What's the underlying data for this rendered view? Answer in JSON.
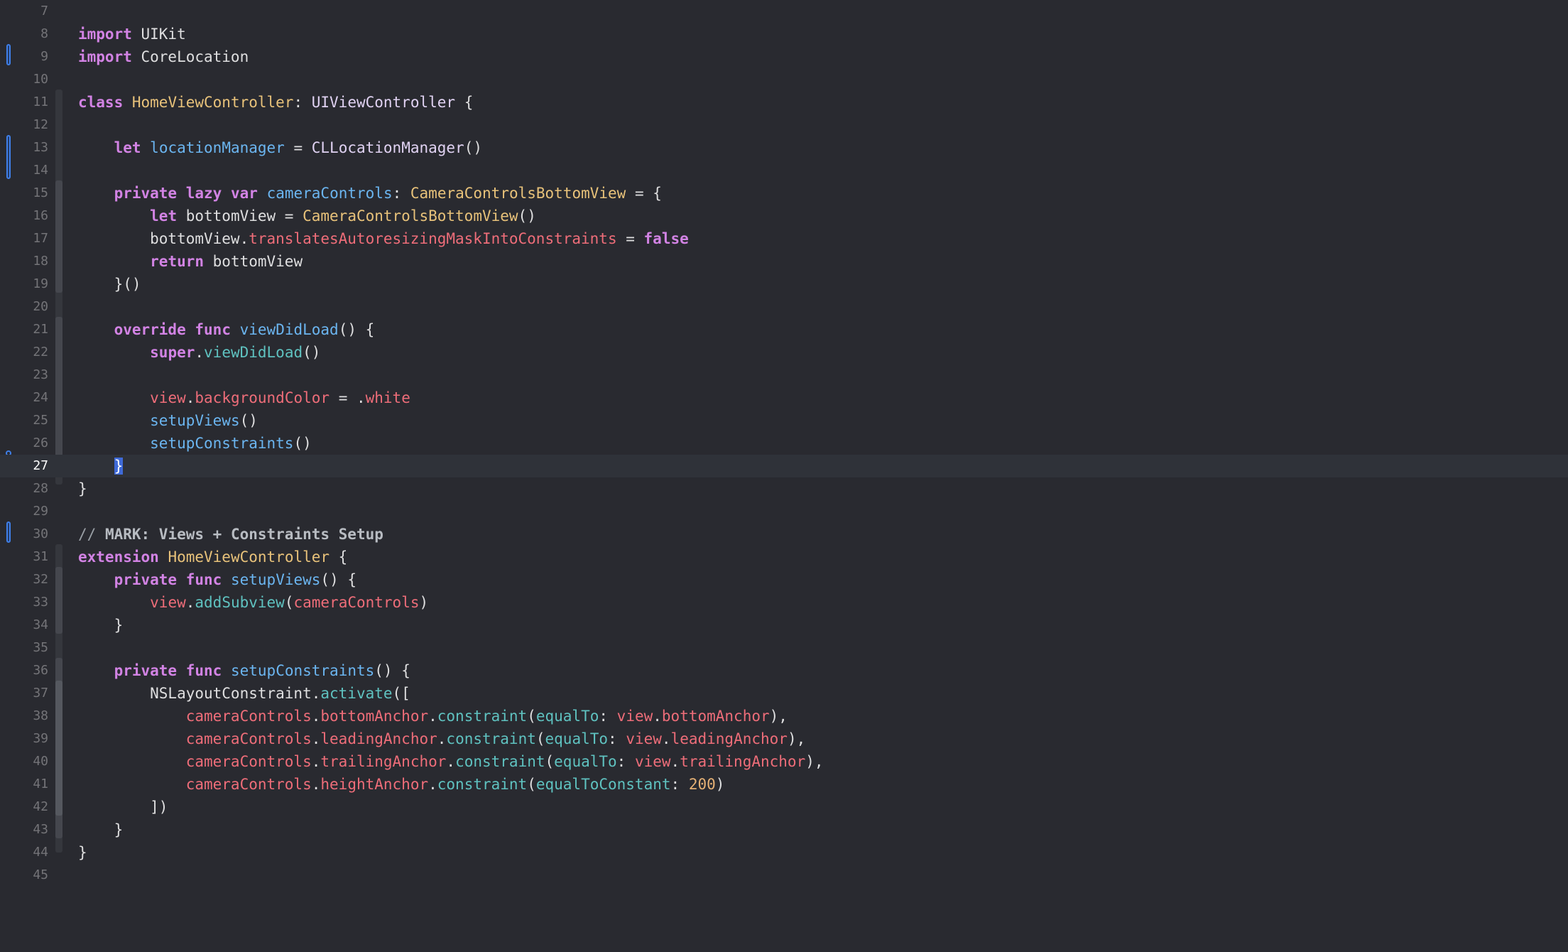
{
  "editor": {
    "language": "swift",
    "current_line": 27,
    "lines": [
      {
        "n": "7",
        "tokens": []
      },
      {
        "n": "8",
        "tokens": [
          {
            "t": "import",
            "c": "kw"
          },
          {
            "t": " UIKit",
            "c": ""
          }
        ]
      },
      {
        "n": "9",
        "tokens": [
          {
            "t": "import",
            "c": "kw"
          },
          {
            "t": " CoreLocation",
            "c": ""
          }
        ]
      },
      {
        "n": "10",
        "tokens": []
      },
      {
        "n": "11",
        "tokens": [
          {
            "t": "class",
            "c": "kw"
          },
          {
            "t": " ",
            "c": ""
          },
          {
            "t": "HomeViewController",
            "c": "typ"
          },
          {
            "t": ": ",
            "c": ""
          },
          {
            "t": "UIViewController",
            "c": "sys"
          },
          {
            "t": " {",
            "c": ""
          }
        ]
      },
      {
        "n": "12",
        "tokens": []
      },
      {
        "n": "13",
        "tokens": [
          {
            "t": "    ",
            "c": ""
          },
          {
            "t": "let",
            "c": "kw"
          },
          {
            "t": " ",
            "c": ""
          },
          {
            "t": "locationManager",
            "c": "decl"
          },
          {
            "t": " = ",
            "c": ""
          },
          {
            "t": "CLLocationManager",
            "c": "sys"
          },
          {
            "t": "()",
            "c": ""
          }
        ]
      },
      {
        "n": "14",
        "tokens": []
      },
      {
        "n": "15",
        "tokens": [
          {
            "t": "    ",
            "c": ""
          },
          {
            "t": "private",
            "c": "kw"
          },
          {
            "t": " ",
            "c": ""
          },
          {
            "t": "lazy",
            "c": "kw"
          },
          {
            "t": " ",
            "c": ""
          },
          {
            "t": "var",
            "c": "kw"
          },
          {
            "t": " ",
            "c": ""
          },
          {
            "t": "cameraControls",
            "c": "decl"
          },
          {
            "t": ": ",
            "c": ""
          },
          {
            "t": "CameraControlsBottomView",
            "c": "typ"
          },
          {
            "t": " = {",
            "c": ""
          }
        ]
      },
      {
        "n": "16",
        "tokens": [
          {
            "t": "        ",
            "c": ""
          },
          {
            "t": "let",
            "c": "kw"
          },
          {
            "t": " bottomView = ",
            "c": ""
          },
          {
            "t": "CameraControlsBottomView",
            "c": "typ"
          },
          {
            "t": "()",
            "c": ""
          }
        ]
      },
      {
        "n": "17",
        "tokens": [
          {
            "t": "        bottomView.",
            "c": ""
          },
          {
            "t": "translatesAutoresizingMaskIntoConstraints",
            "c": "prop"
          },
          {
            "t": " = ",
            "c": ""
          },
          {
            "t": "false",
            "c": "kw"
          }
        ]
      },
      {
        "n": "18",
        "tokens": [
          {
            "t": "        ",
            "c": ""
          },
          {
            "t": "return",
            "c": "kw"
          },
          {
            "t": " bottomView",
            "c": ""
          }
        ]
      },
      {
        "n": "19",
        "tokens": [
          {
            "t": "    }()",
            "c": ""
          }
        ]
      },
      {
        "n": "20",
        "tokens": []
      },
      {
        "n": "21",
        "tokens": [
          {
            "t": "    ",
            "c": ""
          },
          {
            "t": "override",
            "c": "kw"
          },
          {
            "t": " ",
            "c": ""
          },
          {
            "t": "func",
            "c": "kw"
          },
          {
            "t": " ",
            "c": ""
          },
          {
            "t": "viewDidLoad",
            "c": "decl"
          },
          {
            "t": "() {",
            "c": ""
          }
        ]
      },
      {
        "n": "22",
        "tokens": [
          {
            "t": "        ",
            "c": ""
          },
          {
            "t": "super",
            "c": "kw"
          },
          {
            "t": ".",
            "c": ""
          },
          {
            "t": "viewDidLoad",
            "c": "meth"
          },
          {
            "t": "()",
            "c": ""
          }
        ]
      },
      {
        "n": "23",
        "tokens": []
      },
      {
        "n": "24",
        "tokens": [
          {
            "t": "        ",
            "c": ""
          },
          {
            "t": "view",
            "c": "prop"
          },
          {
            "t": ".",
            "c": ""
          },
          {
            "t": "backgroundColor",
            "c": "prop"
          },
          {
            "t": " = .",
            "c": ""
          },
          {
            "t": "white",
            "c": "prop"
          }
        ]
      },
      {
        "n": "25",
        "tokens": [
          {
            "t": "        ",
            "c": ""
          },
          {
            "t": "setupViews",
            "c": "decl"
          },
          {
            "t": "()",
            "c": ""
          }
        ]
      },
      {
        "n": "26",
        "tokens": [
          {
            "t": "        ",
            "c": ""
          },
          {
            "t": "setupConstraints",
            "c": "decl"
          },
          {
            "t": "()",
            "c": ""
          }
        ]
      },
      {
        "n": "27",
        "tokens": [
          {
            "t": "    ",
            "c": ""
          },
          {
            "t": "}",
            "c": "hl"
          }
        ]
      },
      {
        "n": "28",
        "tokens": [
          {
            "t": "}",
            "c": ""
          }
        ]
      },
      {
        "n": "29",
        "tokens": []
      },
      {
        "n": "30",
        "tokens": [
          {
            "t": "// ",
            "c": "cmt"
          },
          {
            "t": "MARK: Views + Constraints Setup",
            "c": "mark"
          }
        ]
      },
      {
        "n": "31",
        "tokens": [
          {
            "t": "extension",
            "c": "kw"
          },
          {
            "t": " ",
            "c": ""
          },
          {
            "t": "HomeViewController",
            "c": "typ"
          },
          {
            "t": " {",
            "c": ""
          }
        ]
      },
      {
        "n": "32",
        "tokens": [
          {
            "t": "    ",
            "c": ""
          },
          {
            "t": "private",
            "c": "kw"
          },
          {
            "t": " ",
            "c": ""
          },
          {
            "t": "func",
            "c": "kw"
          },
          {
            "t": " ",
            "c": ""
          },
          {
            "t": "setupViews",
            "c": "decl"
          },
          {
            "t": "() {",
            "c": ""
          }
        ]
      },
      {
        "n": "33",
        "tokens": [
          {
            "t": "        ",
            "c": ""
          },
          {
            "t": "view",
            "c": "prop"
          },
          {
            "t": ".",
            "c": ""
          },
          {
            "t": "addSubview",
            "c": "meth"
          },
          {
            "t": "(",
            "c": ""
          },
          {
            "t": "cameraControls",
            "c": "prop"
          },
          {
            "t": ")",
            "c": ""
          }
        ]
      },
      {
        "n": "34",
        "tokens": [
          {
            "t": "    }",
            "c": ""
          }
        ]
      },
      {
        "n": "35",
        "tokens": []
      },
      {
        "n": "36",
        "tokens": [
          {
            "t": "    ",
            "c": ""
          },
          {
            "t": "private",
            "c": "kw"
          },
          {
            "t": " ",
            "c": ""
          },
          {
            "t": "func",
            "c": "kw"
          },
          {
            "t": " ",
            "c": ""
          },
          {
            "t": "setupConstraints",
            "c": "decl"
          },
          {
            "t": "() {",
            "c": ""
          }
        ]
      },
      {
        "n": "37",
        "tokens": [
          {
            "t": "        NSLayoutConstraint.",
            "c": ""
          },
          {
            "t": "activate",
            "c": "meth"
          },
          {
            "t": "([",
            "c": ""
          }
        ]
      },
      {
        "n": "38",
        "tokens": [
          {
            "t": "            ",
            "c": ""
          },
          {
            "t": "cameraControls",
            "c": "prop"
          },
          {
            "t": ".",
            "c": ""
          },
          {
            "t": "bottomAnchor",
            "c": "prop"
          },
          {
            "t": ".",
            "c": ""
          },
          {
            "t": "constraint",
            "c": "meth"
          },
          {
            "t": "(",
            "c": ""
          },
          {
            "t": "equalTo",
            "c": "meth"
          },
          {
            "t": ": ",
            "c": ""
          },
          {
            "t": "view",
            "c": "prop"
          },
          {
            "t": ".",
            "c": ""
          },
          {
            "t": "bottomAnchor",
            "c": "prop"
          },
          {
            "t": "),",
            "c": ""
          }
        ]
      },
      {
        "n": "39",
        "tokens": [
          {
            "t": "            ",
            "c": ""
          },
          {
            "t": "cameraControls",
            "c": "prop"
          },
          {
            "t": ".",
            "c": ""
          },
          {
            "t": "leadingAnchor",
            "c": "prop"
          },
          {
            "t": ".",
            "c": ""
          },
          {
            "t": "constraint",
            "c": "meth"
          },
          {
            "t": "(",
            "c": ""
          },
          {
            "t": "equalTo",
            "c": "meth"
          },
          {
            "t": ": ",
            "c": ""
          },
          {
            "t": "view",
            "c": "prop"
          },
          {
            "t": ".",
            "c": ""
          },
          {
            "t": "leadingAnchor",
            "c": "prop"
          },
          {
            "t": "),",
            "c": ""
          }
        ]
      },
      {
        "n": "40",
        "tokens": [
          {
            "t": "            ",
            "c": ""
          },
          {
            "t": "cameraControls",
            "c": "prop"
          },
          {
            "t": ".",
            "c": ""
          },
          {
            "t": "trailingAnchor",
            "c": "prop"
          },
          {
            "t": ".",
            "c": ""
          },
          {
            "t": "constraint",
            "c": "meth"
          },
          {
            "t": "(",
            "c": ""
          },
          {
            "t": "equalTo",
            "c": "meth"
          },
          {
            "t": ": ",
            "c": ""
          },
          {
            "t": "view",
            "c": "prop"
          },
          {
            "t": ".",
            "c": ""
          },
          {
            "t": "trailingAnchor",
            "c": "prop"
          },
          {
            "t": "),",
            "c": ""
          }
        ]
      },
      {
        "n": "41",
        "tokens": [
          {
            "t": "            ",
            "c": ""
          },
          {
            "t": "cameraControls",
            "c": "prop"
          },
          {
            "t": ".",
            "c": ""
          },
          {
            "t": "heightAnchor",
            "c": "prop"
          },
          {
            "t": ".",
            "c": ""
          },
          {
            "t": "constraint",
            "c": "meth"
          },
          {
            "t": "(",
            "c": ""
          },
          {
            "t": "equalToConstant",
            "c": "meth"
          },
          {
            "t": ": ",
            "c": ""
          },
          {
            "t": "200",
            "c": "num-lit"
          },
          {
            "t": ")",
            "c": ""
          }
        ]
      },
      {
        "n": "42",
        "tokens": [
          {
            "t": "        ])",
            "c": ""
          }
        ]
      },
      {
        "n": "43",
        "tokens": [
          {
            "t": "    }",
            "c": ""
          }
        ]
      },
      {
        "n": "44",
        "tokens": [
          {
            "t": "}",
            "c": ""
          }
        ]
      },
      {
        "n": "45",
        "tokens": []
      }
    ]
  },
  "colors": {
    "background": "#292a30",
    "current_line": "#2f3239",
    "change_bar": "#3f7fe8",
    "fold_ribbon": "#45474e",
    "keyword": "#d283e4",
    "type": "#e8c27a",
    "declaration": "#6bb5f0",
    "property": "#ee6d79",
    "method": "#5fc2c0",
    "number": "#e6b175"
  }
}
